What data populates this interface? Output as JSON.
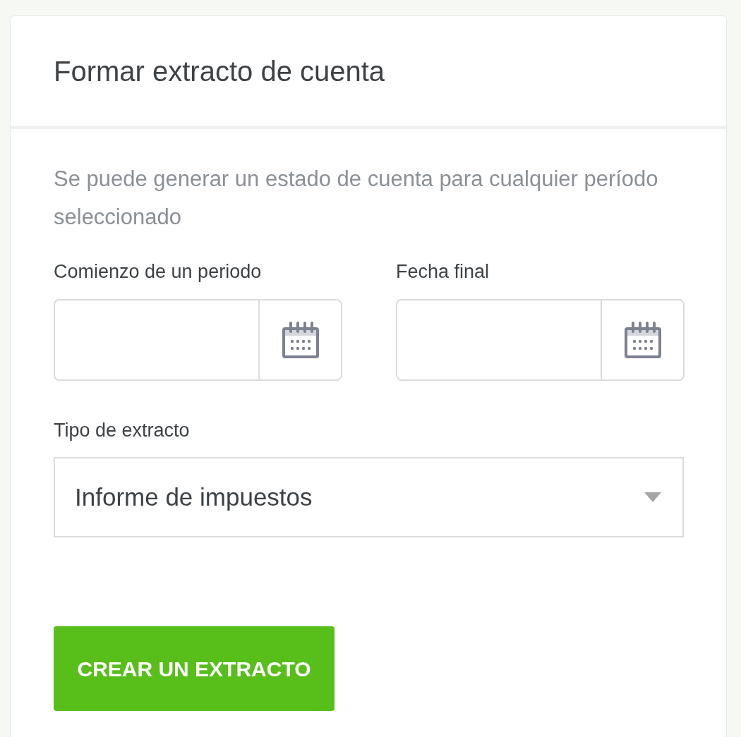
{
  "card": {
    "title": "Formar extracto de cuenta",
    "description": "Se puede generar un estado de cuenta para cualquier período seleccionado",
    "date_fields": [
      {
        "label": "Comienzo de un periodo"
      },
      {
        "label": "Fecha final"
      }
    ],
    "statement_type": {
      "label": "Tipo de extracto",
      "value": "Informe de impuestos"
    },
    "submit_button": "CREAR UN EXTRACTO"
  }
}
